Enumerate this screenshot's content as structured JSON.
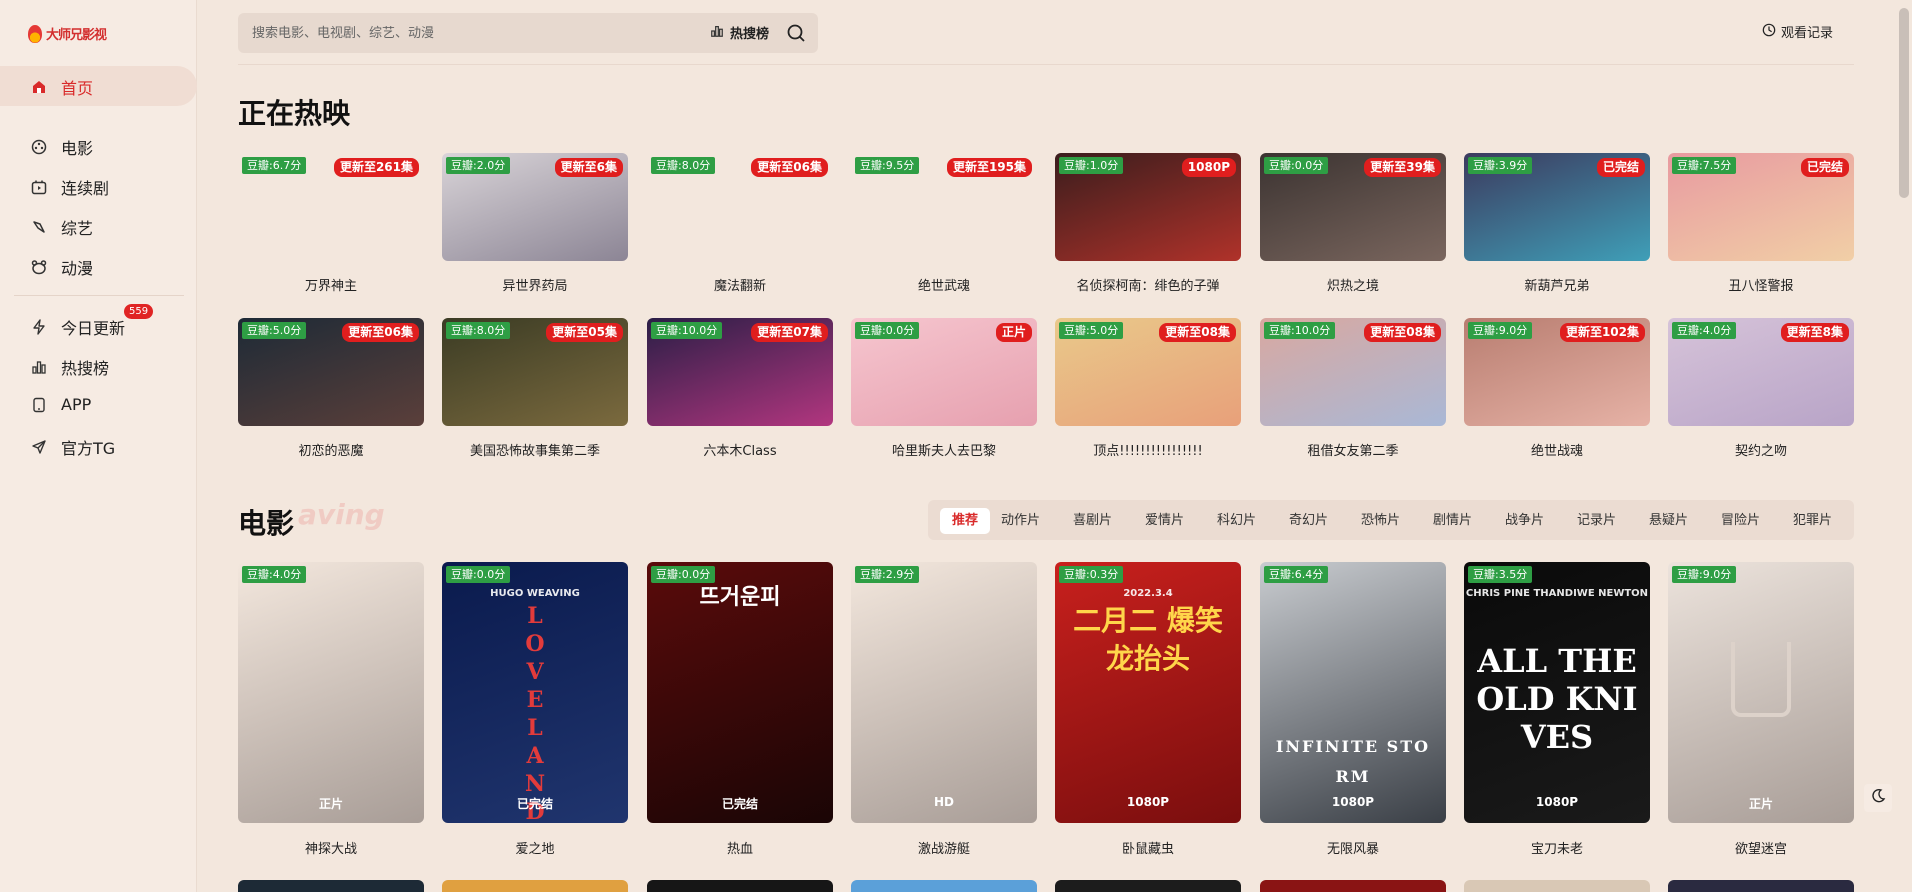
{
  "app": {
    "logo_text": "大师兄影视"
  },
  "sidebar": {
    "items": [
      {
        "label": "首页",
        "icon": "home-icon"
      },
      {
        "label": "电影",
        "icon": "film-reel-icon"
      },
      {
        "label": "连续剧",
        "icon": "tv-icon"
      },
      {
        "label": "综艺",
        "icon": "sparkle-icon"
      },
      {
        "label": "动漫",
        "icon": "bear-face-icon"
      },
      {
        "label": "今日更新",
        "icon": "lightning-icon",
        "badge": "559"
      },
      {
        "label": "热搜榜",
        "icon": "bar-chart-icon"
      },
      {
        "label": "APP",
        "icon": "phone-icon"
      },
      {
        "label": "官方TG",
        "icon": "paper-plane-icon"
      }
    ]
  },
  "header": {
    "search_placeholder": "搜索电影、电视剧、综艺、动漫",
    "hot_label": "热搜榜",
    "history_label": "观看记录"
  },
  "now_showing": {
    "title": "正在热映",
    "items": [
      {
        "title": "万界神主",
        "score": "豆瓣:6.7分",
        "tag": "更新至261集",
        "colors": [
          "#f3e7dd",
          "#f3e7dd"
        ]
      },
      {
        "title": "异世界药局",
        "score": "豆瓣:2.0分",
        "tag": "更新至6集",
        "colors": [
          "#d9d4d8",
          "#8c8595"
        ]
      },
      {
        "title": "魔法翻新",
        "score": "豆瓣:8.0分",
        "tag": "更新至06集",
        "colors": [
          "#f3e7dd",
          "#f3e7dd"
        ]
      },
      {
        "title": "绝世武魂",
        "score": "豆瓣:9.5分",
        "tag": "更新至195集",
        "colors": [
          "#f3e7dd",
          "#f3e7dd"
        ]
      },
      {
        "title": "名侦探柯南：绯色的子弹",
        "score": "豆瓣:1.0分",
        "tag": "1080P",
        "colors": [
          "#3a1d1d",
          "#b0322a"
        ]
      },
      {
        "title": "炽热之境",
        "score": "豆瓣:0.0分",
        "tag": "更新至39集",
        "colors": [
          "#3b3331",
          "#7a665e"
        ]
      },
      {
        "title": "新葫芦兄弟",
        "score": "豆瓣:3.9分",
        "tag": "已完结",
        "colors": [
          "#3c3a5e",
          "#3f9fb8"
        ]
      },
      {
        "title": "丑八怪警报",
        "score": "豆瓣:7.5分",
        "tag": "已完结",
        "colors": [
          "#e89aa0",
          "#f1cfa6"
        ]
      }
    ],
    "items_row2": [
      {
        "title": "初恋的恶魔",
        "score": "豆瓣:5.0分",
        "tag": "更新至06集",
        "colors": [
          "#1d2a36",
          "#5b3f3a"
        ]
      },
      {
        "title": "美国恐怖故事集第二季",
        "score": "豆瓣:8.0分",
        "tag": "更新至05集",
        "colors": [
          "#3a3b24",
          "#7b6a3e"
        ]
      },
      {
        "title": "六本木Class",
        "score": "豆瓣:10.0分",
        "tag": "更新至07集",
        "colors": [
          "#2a1e46",
          "#b2367f"
        ]
      },
      {
        "title": "哈里斯夫人去巴黎",
        "score": "豆瓣:0.0分",
        "tag": "正片",
        "colors": [
          "#f6c6cf",
          "#e6a0af"
        ]
      },
      {
        "title": "顶点!!!!!!!!!!!!!!!!",
        "score": "豆瓣:5.0分",
        "tag": "更新至08集",
        "colors": [
          "#e9c98a",
          "#e8a07a"
        ]
      },
      {
        "title": "租借女友第二季",
        "score": "豆瓣:10.0分",
        "tag": "更新至08集",
        "colors": [
          "#d9a8a0",
          "#a9b8d6"
        ]
      },
      {
        "title": "绝世战魂",
        "score": "豆瓣:9.0分",
        "tag": "更新至102集",
        "colors": [
          "#b87d70",
          "#e6b2a6"
        ]
      },
      {
        "title": "契约之吻",
        "score": "豆瓣:4.0分",
        "tag": "更新至8集",
        "colors": [
          "#d6c3d9",
          "#b8a4c7"
        ]
      }
    ]
  },
  "movies": {
    "title": "电影",
    "ghost_text": "aving",
    "tabs": [
      "推荐",
      "动作片",
      "喜剧片",
      "爱情片",
      "科幻片",
      "奇幻片",
      "恐怖片",
      "剧情片",
      "战争片",
      "记录片",
      "悬疑片",
      "冒险片",
      "犯罪片"
    ],
    "items": [
      {
        "title": "神探大战",
        "score": "豆瓣:4.0分",
        "quality": "正片",
        "colors": [
          "#f3e7dd",
          "#a89d97"
        ]
      },
      {
        "title": "爱之地",
        "score": "豆瓣:0.0分",
        "quality": "已完结",
        "poster_text": "LOVELAND",
        "poster_sub": "HUGO WEAVING",
        "colors": [
          "#0a1a4d",
          "#20356e"
        ]
      },
      {
        "title": "热血",
        "score": "豆瓣:0.0分",
        "quality": "已完结",
        "poster_text": "뜨거운피",
        "colors": [
          "#5a0b0b",
          "#1a0505"
        ]
      },
      {
        "title": "激战游艇",
        "score": "豆瓣:2.9分",
        "quality": "HD",
        "colors": [
          "#f3e7dd",
          "#a89d97"
        ]
      },
      {
        "title": "卧鼠藏虫",
        "score": "豆瓣:0.3分",
        "quality": "1080P",
        "poster_text": "二月二 爆笑龙抬头",
        "poster_sub": "2022.3.4",
        "colors": [
          "#c8201d",
          "#7a0e0e"
        ]
      },
      {
        "title": "无限风暴",
        "score": "豆瓣:6.4分",
        "quality": "1080P",
        "poster_text": "INFINITE STORM",
        "colors": [
          "#c9ccd0",
          "#3a3f46"
        ]
      },
      {
        "title": "宝刀未老",
        "score": "豆瓣:3.5分",
        "quality": "1080P",
        "poster_text": "ALL THE OLD KNIVES",
        "poster_sub": "CHRIS PINE   THANDIWE NEWTON",
        "colors": [
          "#0a0a0a",
          "#1a1a1a"
        ]
      },
      {
        "title": "欲望迷宫",
        "score": "豆瓣:9.0分",
        "quality": "正片",
        "colors": [
          "#ece3dc",
          "#a89d97"
        ]
      }
    ],
    "next_row_colors": [
      "#1d2a36",
      "#e0a040",
      "#161616",
      "#5ba0d9",
      "#1c1c1c",
      "#8a1414",
      "#d9c8b5",
      "#2a2a40"
    ]
  },
  "colors": {
    "accent": "#d92a2a",
    "score_green": "#2e9e44",
    "badge_red": "#e01e1e",
    "background": "#f3e7dd"
  }
}
